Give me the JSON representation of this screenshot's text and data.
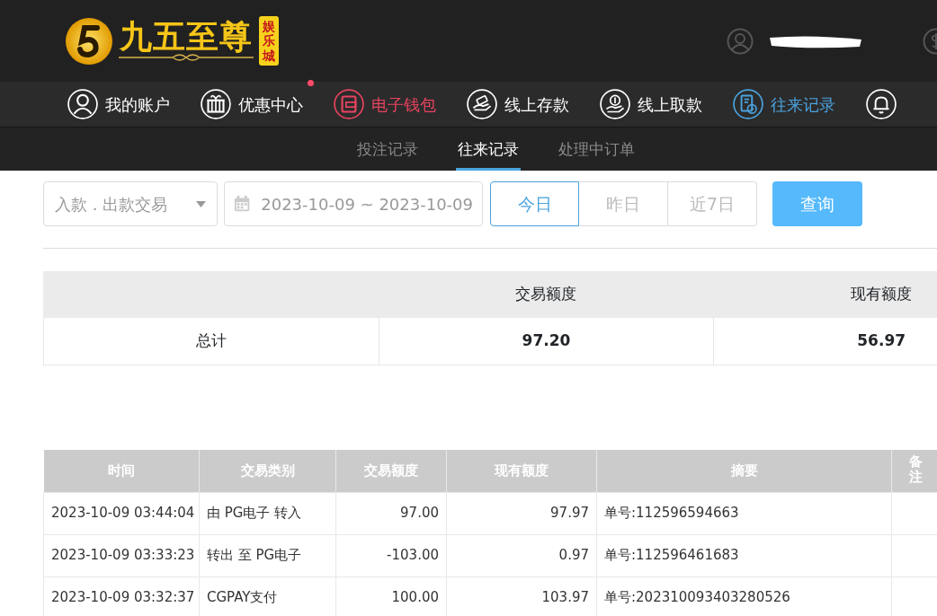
{
  "brand": {
    "name": "九五至尊",
    "tag": "娱乐城"
  },
  "nav": [
    {
      "label": "我的账户",
      "kind": "person",
      "color": "#ffffff",
      "dot": false
    },
    {
      "label": "优惠中心",
      "kind": "gift",
      "color": "#ffffff",
      "dot": true
    },
    {
      "label": "电子钱包",
      "kind": "wallet",
      "color": "#e8435f",
      "dot": false
    },
    {
      "label": "线上存款",
      "kind": "deposit",
      "color": "#ffffff",
      "dot": false
    },
    {
      "label": "线上取款",
      "kind": "withdraw",
      "color": "#ffffff",
      "dot": false
    },
    {
      "label": "往来记录",
      "kind": "records",
      "color": "#4aa3df",
      "dot": false
    },
    {
      "kind": "bell",
      "color": "#ffffff"
    }
  ],
  "subnav": [
    {
      "label": "投注记录",
      "selected": false
    },
    {
      "label": "往来记录",
      "selected": true
    },
    {
      "label": "处理中订单",
      "selected": false
    }
  ],
  "filters": {
    "type": "入款 . 出款交易",
    "date_range": "2023-10-09 ~ 2023-10-09",
    "ranges": [
      {
        "label": "今日",
        "selected": true
      },
      {
        "label": "昨日",
        "selected": false
      },
      {
        "label": "近7日",
        "selected": false
      }
    ],
    "query": "查询"
  },
  "summary": {
    "columns": [
      "交易额度",
      "现有额度"
    ],
    "row": [
      "总计",
      "97.20",
      "56.97"
    ]
  },
  "table": {
    "columns": [
      "时间",
      "交易类别",
      "交易额度",
      "现有额度",
      "摘要",
      "备注"
    ],
    "rows": [
      [
        "2023-10-09 03:44:04",
        "由 PG电子 转入",
        "97.00",
        "97.97",
        "单号:112596594663",
        ""
      ],
      [
        "2023-10-09 03:33:23",
        "转出 至 PG电子",
        "-103.00",
        "0.97",
        "单号:112596461683",
        ""
      ],
      [
        "2023-10-09 03:32:37",
        "CGPAY支付",
        "100.00",
        "103.97",
        "单号:202310093403280526",
        ""
      ]
    ]
  }
}
